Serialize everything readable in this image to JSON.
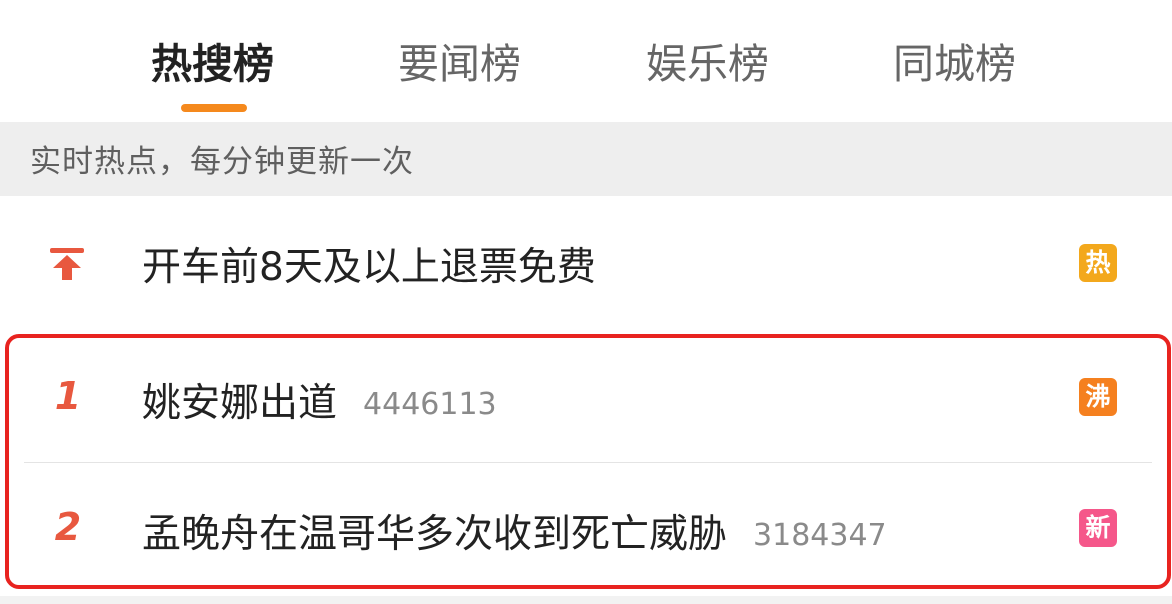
{
  "tabs": [
    {
      "label": "热搜榜",
      "active": true
    },
    {
      "label": "要闻榜",
      "active": false
    },
    {
      "label": "娱乐榜",
      "active": false
    },
    {
      "label": "同城榜",
      "active": false
    }
  ],
  "subheader": "实时热点，每分钟更新一次",
  "rows": [
    {
      "rank_icon": "pin-to-top-icon",
      "title": "开车前8天及以上退票免费",
      "count": "",
      "badge": "热",
      "badge_color": "#f3a81c"
    },
    {
      "rank": "1",
      "title": "姚安娜出道",
      "count": "4446113",
      "badge": "沸",
      "badge_color": "#f5801f"
    },
    {
      "rank": "2",
      "title": "孟晚舟在温哥华多次收到死亡威胁",
      "count": "3184347",
      "badge": "新",
      "badge_color": "#f5578a"
    }
  ],
  "colors": {
    "accent": "#f5891d",
    "rank": "#e8583f",
    "highlight": "#e8231f"
  }
}
